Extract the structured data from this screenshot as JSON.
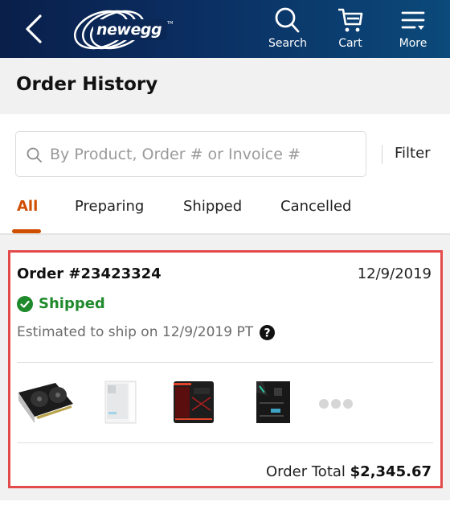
{
  "header": {
    "brand": "newegg",
    "nav": [
      {
        "label": "Search",
        "icon": "search-icon"
      },
      {
        "label": "Cart",
        "icon": "cart-icon"
      },
      {
        "label": "More",
        "icon": "menu-icon"
      }
    ],
    "colors": {
      "from": "#0a1f4a",
      "to": "#0b4a7a"
    }
  },
  "page": {
    "title": "Order History"
  },
  "search": {
    "placeholder": "By Product, Order # or Invoice #",
    "value": "",
    "filter_label": "Filter"
  },
  "tabs": [
    {
      "label": "All",
      "active": true
    },
    {
      "label": "Preparing",
      "active": false
    },
    {
      "label": "Shipped",
      "active": false
    },
    {
      "label": "Cancelled",
      "active": false
    }
  ],
  "accent_color": "#d04e00",
  "order": {
    "number": "Order #23423324",
    "date": "12/9/2019",
    "status": "Shipped",
    "status_color": "#1f8a2c",
    "estimate": "Estimated to ship on 12/9/2019 PT",
    "items": [
      {
        "name": "graphics-card",
        "icon": "graphics-card-image"
      },
      {
        "name": "white-pc-case",
        "icon": "white-case-image"
      },
      {
        "name": "black-red-pc-case",
        "icon": "red-case-image"
      },
      {
        "name": "motherboard",
        "icon": "motherboard-image"
      }
    ],
    "total_label": "Order Total",
    "total_value": "$2,345.67",
    "highlight_color": "#e34b4b"
  }
}
